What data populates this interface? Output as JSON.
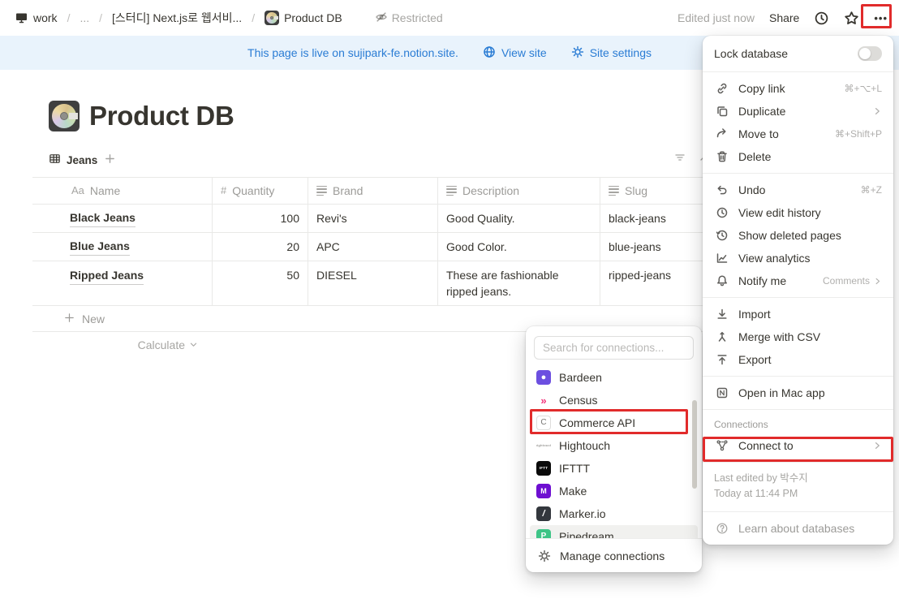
{
  "topbar": {
    "workspace": "work",
    "ellipsis": "...",
    "crumb_page": "[스터디] Next.js로 웹서비...",
    "current_page": "Product DB",
    "restricted_label": "Restricted",
    "edited_label": "Edited just now",
    "share_label": "Share",
    "more_label": "•••"
  },
  "banner": {
    "message": "This page is live on sujipark-fe.notion.site.",
    "view_site_label": "View site",
    "site_settings_label": "Site settings"
  },
  "page": {
    "title": "Product DB",
    "view_tab_label": "Jeans"
  },
  "table": {
    "headers": [
      {
        "icon_text": "Aa",
        "label": "Name"
      },
      {
        "icon_text": "#",
        "label": "Quantity"
      },
      {
        "icon_text": "",
        "label": "Brand"
      },
      {
        "icon_text": "",
        "label": "Description"
      },
      {
        "icon_text": "",
        "label": "Slug"
      }
    ],
    "rows": [
      {
        "name": "Black Jeans",
        "quantity": "100",
        "brand": "Revi's",
        "description": "Good Quality.",
        "slug": "black-jeans"
      },
      {
        "name": "Blue Jeans",
        "quantity": "20",
        "brand": "APC",
        "description": "Good Color.",
        "slug": "blue-jeans"
      },
      {
        "name": "Ripped Jeans",
        "quantity": "50",
        "brand": "DIESEL",
        "description": "These are fashionable ripped jeans.",
        "slug": "ripped-jeans"
      }
    ],
    "new_row_label": "New",
    "calculate_label": "Calculate"
  },
  "popup": {
    "search_placeholder": "Search for connections...",
    "items": [
      {
        "label": "Bardeen",
        "glyph": "●",
        "color": "#6c4fe0"
      },
      {
        "label": "Census",
        "glyph": "»",
        "color": "#f2357b"
      },
      {
        "label": "Commerce API",
        "glyph": "C",
        "color": "#ffffff"
      },
      {
        "label": "Hightouch",
        "glyph": "hightouch",
        "color": "#9b9a97"
      },
      {
        "label": "IFTTT",
        "glyph": "IFTT",
        "color": "#0a0a0a"
      },
      {
        "label": "Make",
        "glyph": "M",
        "color": "#6e0fd1"
      },
      {
        "label": "Marker.io",
        "glyph": "/",
        "color": "#33373d"
      },
      {
        "label": "Pipedream",
        "glyph": "P",
        "color": "#3ec486"
      }
    ],
    "manage_connections_label": "Manage connections"
  },
  "menu": {
    "lock_database_label": "Lock database",
    "copy_link": {
      "label": "Copy link",
      "shortcut": "⌘+⌥+L"
    },
    "duplicate": {
      "label": "Duplicate"
    },
    "move_to": {
      "label": "Move to",
      "shortcut": "⌘+Shift+P"
    },
    "delete": {
      "label": "Delete"
    },
    "undo": {
      "label": "Undo",
      "shortcut": "⌘+Z"
    },
    "view_edit_history": {
      "label": "View edit history"
    },
    "show_deleted_pages": {
      "label": "Show deleted pages"
    },
    "view_analytics": {
      "label": "View analytics"
    },
    "notify_me": {
      "label": "Notify me",
      "right_label": "Comments"
    },
    "import": {
      "label": "Import"
    },
    "merge_with_csv": {
      "label": "Merge with CSV"
    },
    "export": {
      "label": "Export"
    },
    "open_in_mac_app": {
      "label": "Open in Mac app"
    },
    "connections_section_label": "Connections",
    "connect_to": {
      "label": "Connect to"
    },
    "last_edited_by": "Last edited by 박수지",
    "last_edited_time": "Today at 11:44 PM",
    "learn_about_databases_label": "Learn about databases"
  },
  "colors": {
    "accent_blue": "#2a7cd4",
    "annotation_red": "#e12b2b",
    "banner_background": "#e9f3fc"
  }
}
